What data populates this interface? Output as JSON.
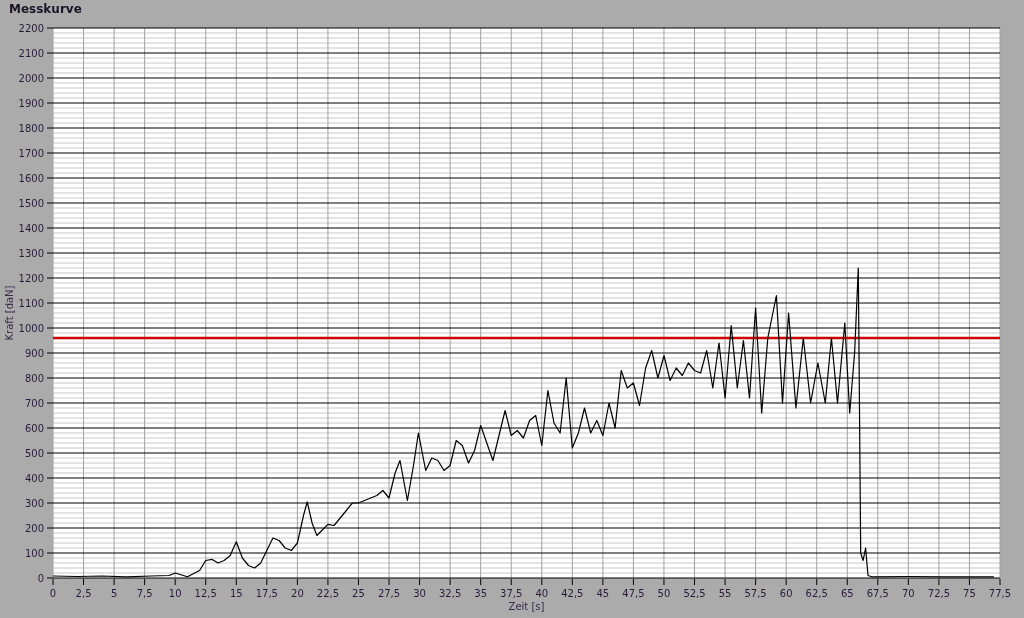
{
  "title": "Messkurve",
  "chart": {
    "chart_data": {
      "type": "line",
      "xlabel": "Zeit [s]",
      "ylabel": "Kraft [daN]",
      "xlim": [
        0,
        77.5
      ],
      "ylim": [
        0,
        2200
      ],
      "xticks": [
        0,
        {
          "value": 2.5,
          "label": "2,5"
        },
        5,
        {
          "value": 7.5,
          "label": "7,5"
        },
        10,
        {
          "value": 12.5,
          "label": "12,5"
        },
        15,
        {
          "value": 17.5,
          "label": "17,5"
        },
        20,
        {
          "value": 22.5,
          "label": "22,5"
        },
        25,
        {
          "value": 27.5,
          "label": "27,5"
        },
        30,
        {
          "value": 32.5,
          "label": "32,5"
        },
        35,
        {
          "value": 37.5,
          "label": "37,5"
        },
        40,
        {
          "value": 42.5,
          "label": "42,5"
        },
        45,
        {
          "value": 47.5,
          "label": "47,5"
        },
        50,
        {
          "value": 52.5,
          "label": "52,5"
        },
        55,
        {
          "value": 57.5,
          "label": "57,5"
        },
        60,
        {
          "value": 62.5,
          "label": "62,5"
        },
        65,
        {
          "value": 67.5,
          "label": "67,5"
        },
        70,
        {
          "value": 72.5,
          "label": "72,5"
        },
        75,
        {
          "value": 77.5,
          "label": "77,5"
        }
      ],
      "yticks": [
        0,
        100,
        200,
        300,
        400,
        500,
        600,
        700,
        800,
        900,
        1000,
        1100,
        1200,
        1300,
        1400,
        1500,
        1600,
        1700,
        1800,
        1900,
        2000,
        2100,
        2200
      ],
      "x": [
        0,
        2,
        4,
        6,
        8,
        9.5,
        10,
        11,
        12,
        12.5,
        13,
        13.5,
        14,
        14.5,
        15,
        15.5,
        16,
        16.5,
        17,
        17.5,
        18,
        18.5,
        19,
        19.5,
        20,
        20.5,
        20.8,
        21.2,
        21.6,
        22,
        22.5,
        23,
        23.5,
        24,
        24.5,
        25,
        25.5,
        26,
        26.5,
        27,
        27.5,
        28,
        28.4,
        29,
        29.5,
        29.9,
        30.5,
        31,
        31.5,
        32,
        32.5,
        33,
        33.5,
        34,
        34.5,
        35,
        35.5,
        36,
        36.5,
        37,
        37.5,
        38,
        38.5,
        39,
        39.5,
        40,
        40.5,
        41,
        41.5,
        42,
        42.5,
        43,
        43.5,
        44,
        44.5,
        45,
        45.5,
        46,
        46.5,
        47,
        47.5,
        48,
        48.5,
        49,
        49.5,
        50,
        50.5,
        51,
        51.5,
        52,
        52.5,
        53,
        53.5,
        54,
        54.5,
        55,
        55.5,
        56,
        56.5,
        57,
        57.5,
        58,
        58.5,
        59.2,
        59.7,
        60.2,
        60.8,
        61.4,
        62,
        62.6,
        63.2,
        63.7,
        64.2,
        64.8,
        65.2,
        65.6,
        65.9,
        66.1,
        66.3,
        66.5,
        66.7,
        67,
        70,
        73,
        77
      ],
      "series": [
        {
          "color": "#000000",
          "values": [
            8,
            6,
            8,
            5,
            8,
            10,
            20,
            5,
            30,
            70,
            75,
            60,
            70,
            90,
            145,
            80,
            50,
            40,
            60,
            110,
            160,
            150,
            120,
            110,
            140,
            250,
            305,
            220,
            170,
            190,
            215,
            210,
            240,
            270,
            300,
            300,
            310,
            320,
            330,
            350,
            320,
            420,
            470,
            310,
            450,
            580,
            430,
            480,
            470,
            430,
            450,
            550,
            530,
            460,
            510,
            610,
            540,
            470,
            570,
            670,
            570,
            590,
            560,
            630,
            650,
            530,
            750,
            620,
            580,
            800,
            520,
            580,
            680,
            580,
            630,
            570,
            700,
            600,
            830,
            760,
            780,
            690,
            840,
            910,
            800,
            890,
            790,
            840,
            810,
            860,
            830,
            820,
            910,
            760,
            940,
            720,
            1010,
            760,
            950,
            720,
            1080,
            660,
            960,
            1130,
            700,
            1060,
            680,
            960,
            700,
            860,
            700,
            960,
            700,
            1020,
            660,
            900,
            1240,
            100,
            70,
            120,
            10,
            5,
            6,
            5,
            5
          ]
        }
      ],
      "grid": true,
      "ref_lines": [
        {
          "axis": "y",
          "value": 960,
          "color": "#cc0000"
        }
      ]
    }
  }
}
